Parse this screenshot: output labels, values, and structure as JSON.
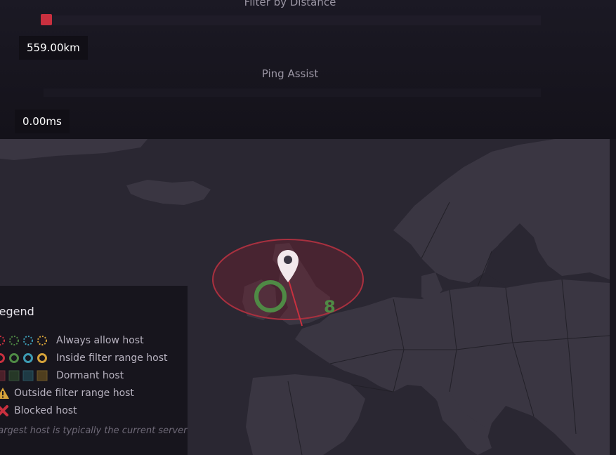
{
  "filter": {
    "distance_title": "Filter by Distance",
    "distance_value": "559.00km",
    "ping_title": "Ping Assist",
    "ping_value": "0.00ms"
  },
  "map": {
    "server_count": "8"
  },
  "legend": {
    "title": "Legend",
    "items": [
      {
        "label": "Always allow host"
      },
      {
        "label": "Inside filter range host"
      },
      {
        "label": "Dormant host"
      },
      {
        "label": "Outside filter range host"
      },
      {
        "label": "Blocked host"
      }
    ],
    "note": "Largest host is typically the current server",
    "colors": {
      "red": "#c9303f",
      "green": "#4f8a45",
      "blue": "#3d9bb3",
      "orange": "#d5a23a"
    }
  }
}
